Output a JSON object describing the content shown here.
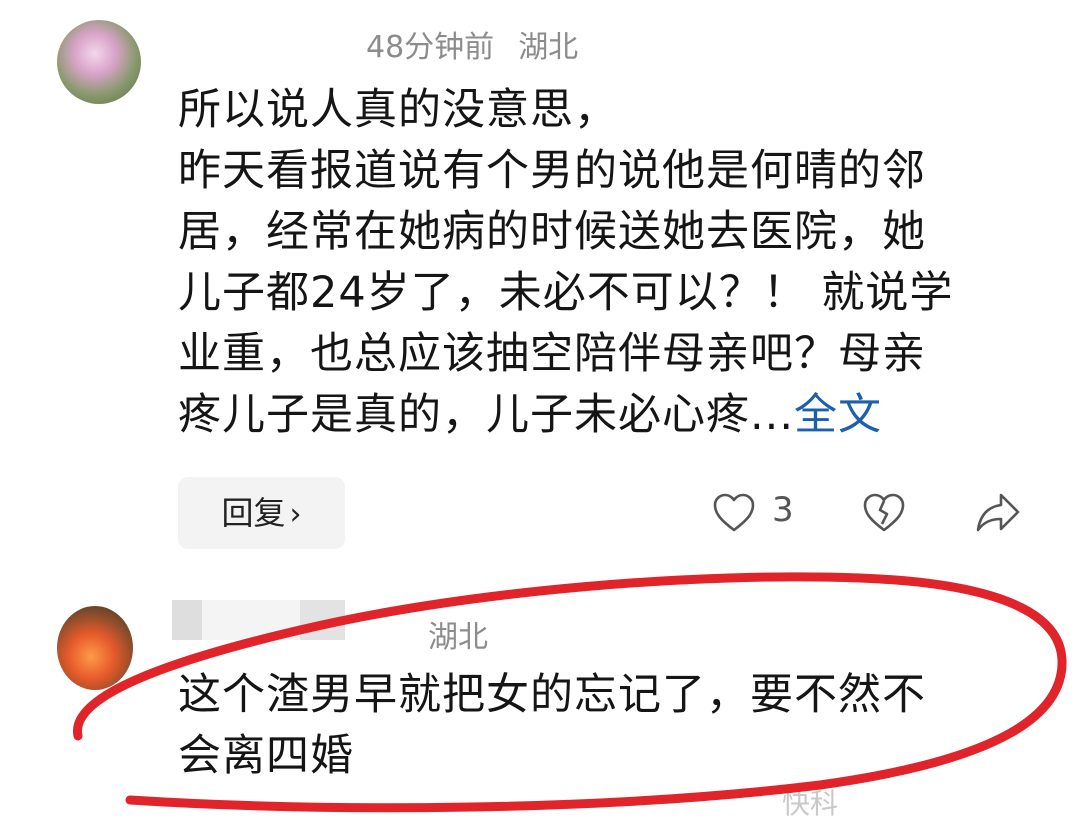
{
  "comments": [
    {
      "time": "48分钟前",
      "location": "湖北",
      "lines": [
        "所以说人真的没意思，",
        "昨天看报道说有个男的说他是何晴的邻",
        "居，经常在她病的时候送她去医院，她",
        "儿子都24岁了，未必不可以？！ 就说学",
        "业重，也总应该抽空陪伴母亲吧？母亲",
        "疼儿子是真的，儿子未必心疼..."
      ],
      "more_label": "全文",
      "reply_label": "回复",
      "like_count": "3",
      "icons": [
        "heart-icon",
        "broken-heart-icon",
        "share-arrow-icon"
      ]
    },
    {
      "location": "湖北",
      "lines": [
        "这个渣男早就把女的忘记了，要不然不",
        "会离四婚"
      ]
    }
  ],
  "annotation_color": "#e0242a",
  "link_color": "#1b5fae",
  "watermark": "快科"
}
